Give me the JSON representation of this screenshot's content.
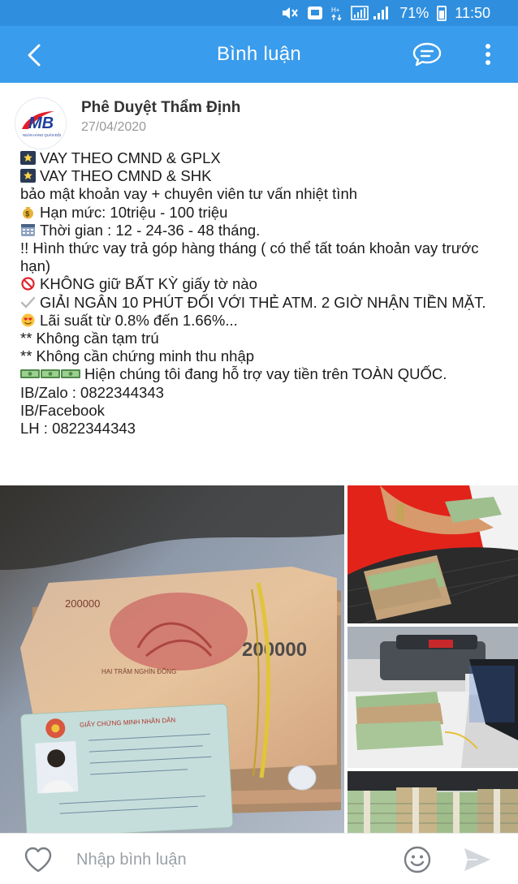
{
  "status_bar": {
    "battery_percent": "71%",
    "time": "11:50",
    "icons": [
      "mute-icon",
      "notification-icon",
      "hd-icon",
      "signal-icon",
      "battery-icon"
    ]
  },
  "app_bar": {
    "title": "Bình luận",
    "back_icon": "chevron-left-icon",
    "chat_icon": "chat-bubble-icon",
    "more_icon": "more-vertical-icon"
  },
  "post": {
    "author": "Phê Duyệt Thẩm Định",
    "avatar_logo_text": "MB",
    "avatar_sub_text": "NGÂN HÀNG QUÂN ĐỘI",
    "date": "27/04/2020",
    "lines": {
      "l1": "VAY THEO CMND & GPLX",
      "l2": "VAY THEO CMND & SHK",
      "l3": "bảo mật khoản vay + chuyên viên tư vấn nhiệt tình",
      "l4": "Hạn mức: 10triệu - 100 triệu",
      "l5": "Thời gian : 12 - 24-36 - 48 tháng.",
      "l6": "!! Hình thức vay trả góp hàng tháng ( có thể tất toán khoản vay trước hạn)",
      "l7": "KHÔNG giữ BẤT KỲ giấy tờ nào",
      "l8": "GIẢI NGÂN 10 PHÚT ĐỐI VỚI THẺ ATM. 2 GIỜ NHẬN TIỀN MẶT.",
      "l9": "Lãi suất từ 0.8% đến 1.66%...",
      "l10": "** Không cần tạm trú",
      "l11": "** Không cần chứng minh thu nhập",
      "l12": "Hiện chúng tôi đang hỗ trợ vay tiền trên TOÀN QUỐC.",
      "l13": "IB/Zalo : 0822344343",
      "l14": "IB/Facebook",
      "l15": "LH : 0822344343"
    },
    "photo_texts": {
      "banknote_value": "200000",
      "banknote_value_small": "200000",
      "banknote_words": "HAI TRĂM NGHÌN ĐỒNG",
      "id_card_title": "GIẤY CHỨNG MINH NHÂN DÂN"
    }
  },
  "bottom_bar": {
    "placeholder": "Nhập bình luận",
    "like_icon": "heart-outline-icon",
    "emoji_icon": "smiley-icon",
    "send_icon": "send-icon"
  },
  "colors": {
    "app_bar": "#3a9cec",
    "status_bar": "#2f8fde",
    "text": "#1b1b1b",
    "date": "#999999"
  }
}
